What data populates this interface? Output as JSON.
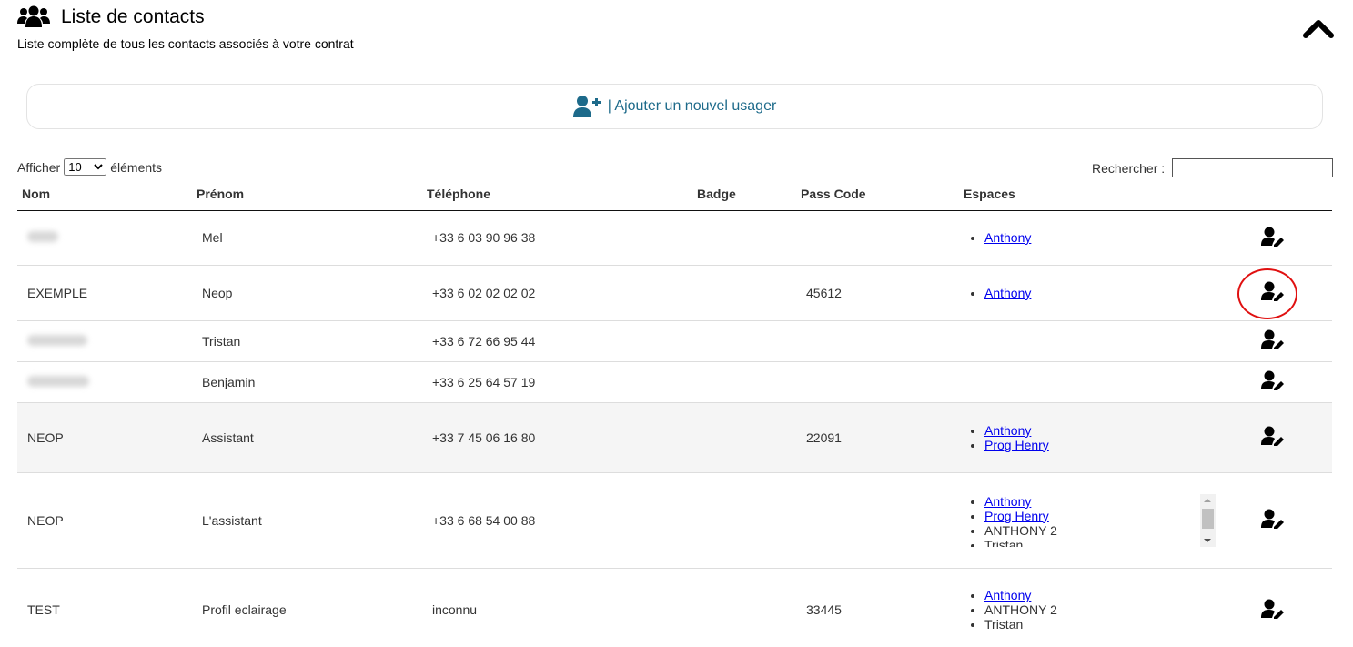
{
  "header": {
    "title": "Liste de contacts",
    "subtitle": "Liste complète de tous les contacts associés à votre contrat",
    "icon": "users-icon",
    "collapse_icon": "chevron-up-icon"
  },
  "add_user": {
    "label": "| Ajouter un nouvel usager",
    "icon": "user-plus-icon",
    "color": "#1d6a8a"
  },
  "table_controls": {
    "show_prefix": "Afficher",
    "show_value": "10",
    "show_suffix": "éléments",
    "search_label": "Rechercher :",
    "search_value": ""
  },
  "table": {
    "columns": [
      "Nom",
      "Prénom",
      "Téléphone",
      "Badge",
      "Pass Code",
      "Espaces"
    ],
    "rows": [
      {
        "nom": "",
        "nom_redacted": true,
        "prenom": "Mel",
        "telephone": "+33 6 03 90 96 38",
        "badge": "",
        "pass_code": "",
        "espaces": [
          {
            "label": "Anthony",
            "link": true
          }
        ]
      },
      {
        "nom": "EXEMPLE",
        "nom_redacted": false,
        "prenom": "Neop",
        "telephone": "+33 6 02 02 02 02",
        "badge": "",
        "pass_code": "45612",
        "espaces": [
          {
            "label": "Anthony",
            "link": true
          }
        ],
        "highlighted": true
      },
      {
        "nom": "",
        "nom_redacted": true,
        "prenom": "Tristan",
        "telephone": "+33 6 72 66 95 44",
        "badge": "",
        "pass_code": "",
        "espaces": []
      },
      {
        "nom": "",
        "nom_redacted": true,
        "prenom": "Benjamin",
        "telephone": "+33 6 25 64 57 19",
        "badge": "",
        "pass_code": "",
        "espaces": []
      },
      {
        "nom": "NEOP",
        "nom_redacted": false,
        "prenom": "Assistant",
        "telephone": "+33 7 45 06 16 80",
        "badge": "",
        "pass_code": "22091",
        "espaces": [
          {
            "label": "Anthony",
            "link": true
          },
          {
            "label": "Prog Henry",
            "link": true
          }
        ]
      },
      {
        "nom": "NEOP",
        "nom_redacted": false,
        "prenom": "L'assistant",
        "telephone": "+33 6 68 54 00 88",
        "badge": "",
        "pass_code": "",
        "espaces": [
          {
            "label": "Anthony",
            "link": true
          },
          {
            "label": "Prog Henry",
            "link": true
          },
          {
            "label": "ANTHONY 2",
            "link": false
          },
          {
            "label": "Tristan",
            "link": false
          }
        ],
        "scrollable": true
      },
      {
        "nom": "TEST",
        "nom_redacted": false,
        "prenom": "Profil eclairage",
        "telephone": "inconnu",
        "badge": "",
        "pass_code": "33445",
        "espaces": [
          {
            "label": "Anthony",
            "link": true
          },
          {
            "label": "ANTHONY 2",
            "link": false
          },
          {
            "label": "Tristan",
            "link": false
          }
        ]
      }
    ],
    "edit_icon": "user-edit-icon",
    "highlight_color": "#e01010"
  }
}
